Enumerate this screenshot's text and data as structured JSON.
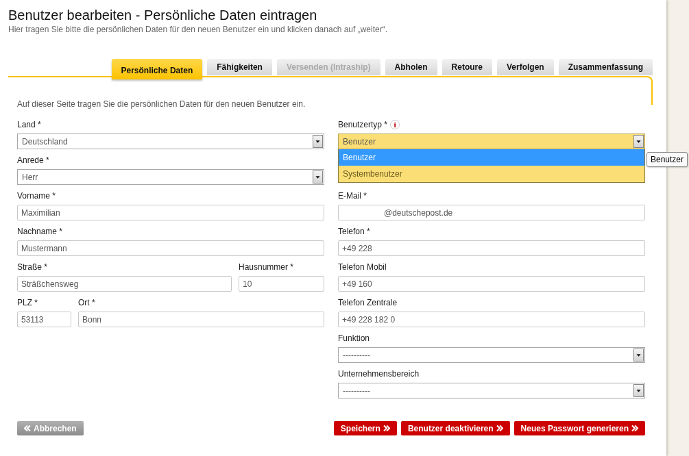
{
  "page": {
    "title": "Benutzer bearbeiten - Persönliche Daten eintragen",
    "subtitle": "Hier tragen Sie bitte die persönlichen Daten für den neuen Benutzer ein und klicken danach auf „weiter“."
  },
  "tabs": [
    {
      "label": "Persönliche Daten",
      "selected": true,
      "disabled": false
    },
    {
      "label": "Fähigkeiten",
      "selected": false,
      "disabled": false
    },
    {
      "label": "Versenden (Intraship)",
      "selected": false,
      "disabled": true
    },
    {
      "label": "Abholen",
      "selected": false,
      "disabled": false
    },
    {
      "label": "Retoure",
      "selected": false,
      "disabled": false
    },
    {
      "label": "Verfolgen",
      "selected": false,
      "disabled": false
    },
    {
      "label": "Zusammenfassung",
      "selected": false,
      "disabled": false
    }
  ],
  "intro": "Auf dieser Seite tragen Sie die persönlichen Daten für den neuen Benutzer ein.",
  "left": [
    {
      "fields": [
        {
          "kind": "select",
          "label": "Land *",
          "value": "Deutschland"
        }
      ]
    },
    {
      "fields": [
        {
          "kind": "select",
          "label": "Anrede *",
          "value": "Herr"
        }
      ]
    },
    {
      "fields": [
        {
          "kind": "input",
          "label": "Vorname *",
          "value": "Maximilian"
        }
      ]
    },
    {
      "fields": [
        {
          "kind": "input",
          "label": "Nachname *",
          "value": "Mustermann"
        }
      ]
    },
    {
      "fields": [
        {
          "kind": "input",
          "label": "Straße *",
          "value": "Sträßchensweg"
        },
        {
          "kind": "input",
          "label": "Hausnummer *",
          "value": "10"
        }
      ]
    },
    {
      "fields": [
        {
          "kind": "input",
          "label": "PLZ *",
          "value": "53113"
        },
        {
          "kind": "input",
          "label": "Ort *",
          "value": "Bonn"
        }
      ]
    }
  ],
  "right": [
    {
      "fields": [
        {
          "kind": "select",
          "label": "Benutzertyp *",
          "info": "i",
          "value": "Benutzer",
          "open": true,
          "options": [
            {
              "label": "Benutzer",
              "selected": true
            },
            {
              "label": "Systembenutzer",
              "selected": false
            }
          ],
          "tooltip": "Benutzer"
        }
      ]
    },
    {
      "fields": [
        {
          "kind": "input",
          "label": "E-Mail *",
          "value": "@deutschepost.de",
          "indent": true
        }
      ]
    },
    {
      "fields": [
        {
          "kind": "input",
          "label": "Telefon *",
          "value": "+49 228"
        }
      ]
    },
    {
      "fields": [
        {
          "kind": "input",
          "label": "Telefon Mobil",
          "value": "+49 160"
        }
      ]
    },
    {
      "fields": [
        {
          "kind": "input",
          "label": "Telefon Zentrale",
          "value": "+49 228 182 0"
        }
      ]
    },
    {
      "fields": [
        {
          "kind": "select",
          "label": "Funktion",
          "value": "----------"
        }
      ]
    },
    {
      "fields": [
        {
          "kind": "select",
          "label": "Unternehmensbereich",
          "value": "----------"
        }
      ]
    }
  ],
  "cancel": {
    "label": "Abbrechen"
  },
  "actions": [
    {
      "label": "Speichern"
    },
    {
      "label": "Benutzer deaktivieren"
    },
    {
      "label": "Neues Passwort generieren"
    }
  ]
}
